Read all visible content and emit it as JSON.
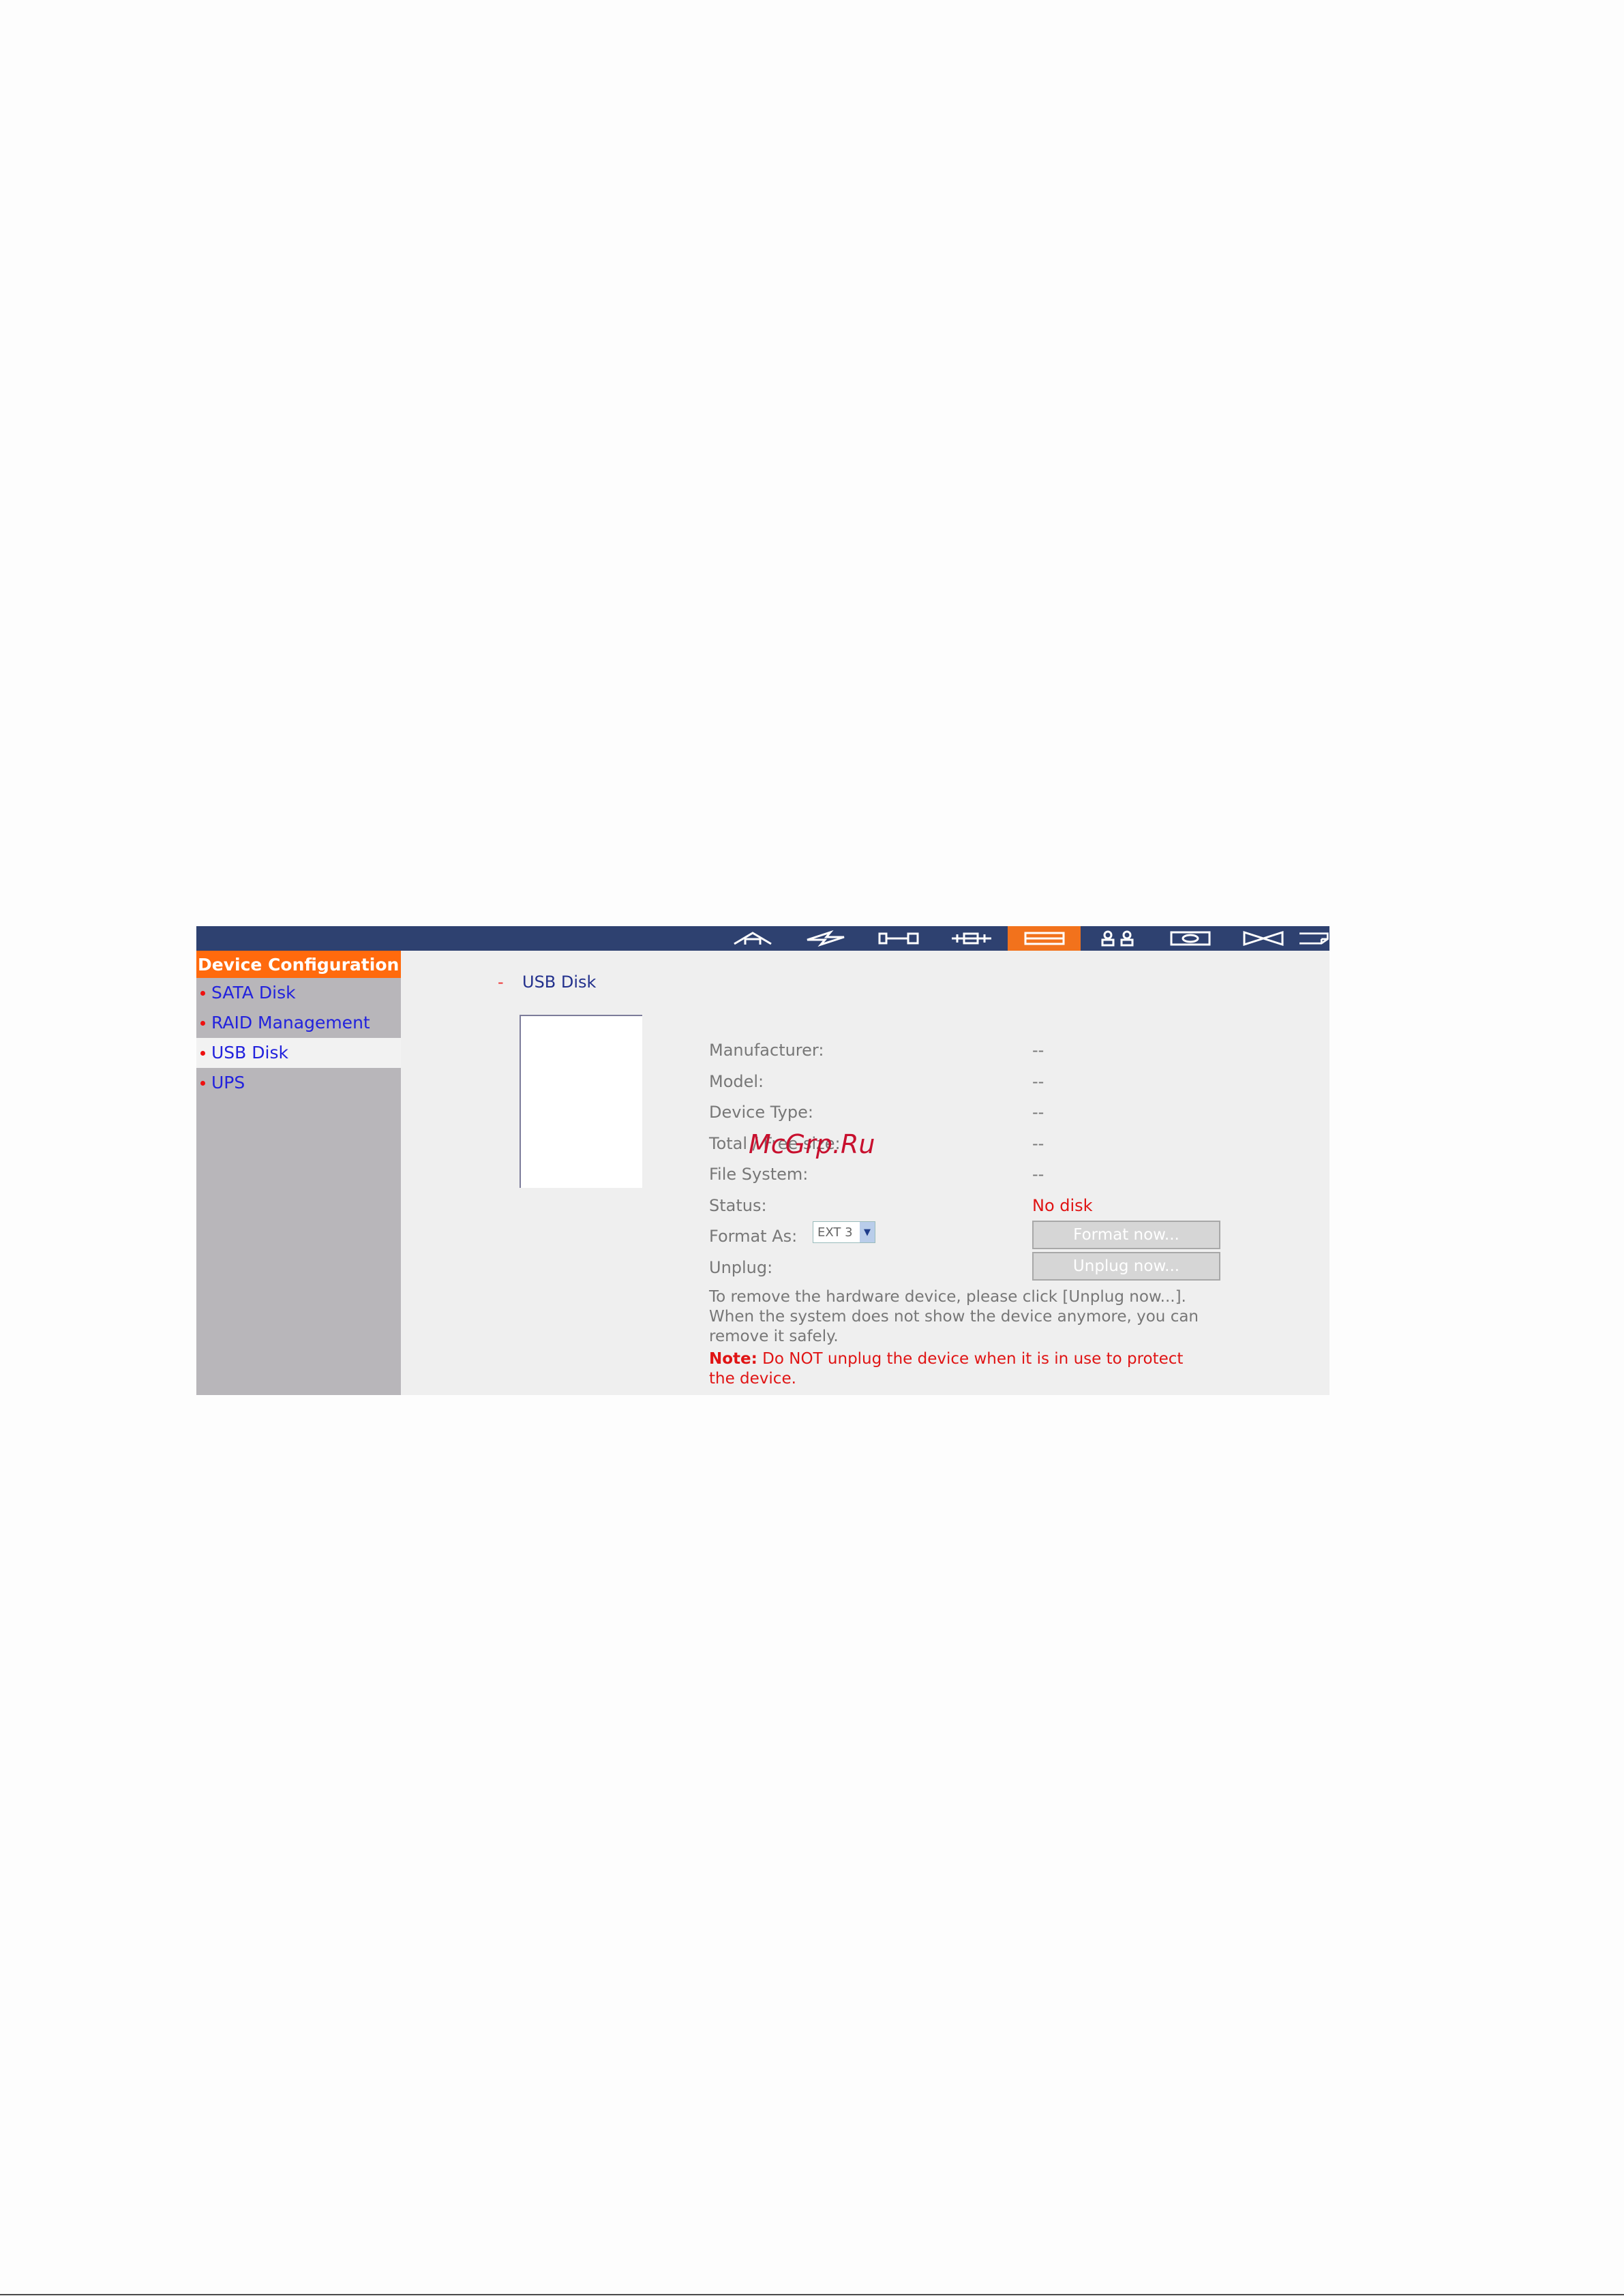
{
  "watermark": "McGrp.Ru",
  "nav": {
    "icons": [
      "home-icon",
      "quick-config-icon",
      "system-tools-icon",
      "network-icon",
      "device-config-icon",
      "users-icon",
      "disk-icon",
      "share-icon",
      "system-status-icon"
    ],
    "active_index": 4
  },
  "sidebar": {
    "header": "Device Configuration",
    "items": [
      {
        "label": "SATA Disk"
      },
      {
        "label": "RAID Management Tool"
      },
      {
        "label": "USB Disk"
      },
      {
        "label": "UPS"
      }
    ],
    "active_index": 2
  },
  "main": {
    "section_dash": "-",
    "section_title": "USB Disk",
    "fields": [
      {
        "label": "Manufacturer:",
        "value": "--"
      },
      {
        "label": "Model:",
        "value": "--"
      },
      {
        "label": "Device Type:",
        "value": "--"
      },
      {
        "label": "Total / Free size:",
        "value": "--"
      },
      {
        "label": "File System:",
        "value": "--"
      },
      {
        "label": "Status:",
        "value": "No disk"
      },
      {
        "label": "Format As:"
      },
      {
        "label": "Unplug:"
      }
    ],
    "format_select_value": "EXT 3",
    "format_button": "Format now...",
    "unplug_button": "Unplug now...",
    "info": "To remove the hardware device, please click [Unplug now...]. When the system does not show the device anymore, you can remove it safely.",
    "note_label": "Note:",
    "note_text": " Do NOT unplug the device when it is in use to protect the device."
  },
  "colors": {
    "topbar": "#2e4170",
    "accent": "#ff6a0d",
    "sidebar": "#b8b6ba",
    "content_bg": "#efefef",
    "link": "#2222dd",
    "alert": "#e01414"
  }
}
